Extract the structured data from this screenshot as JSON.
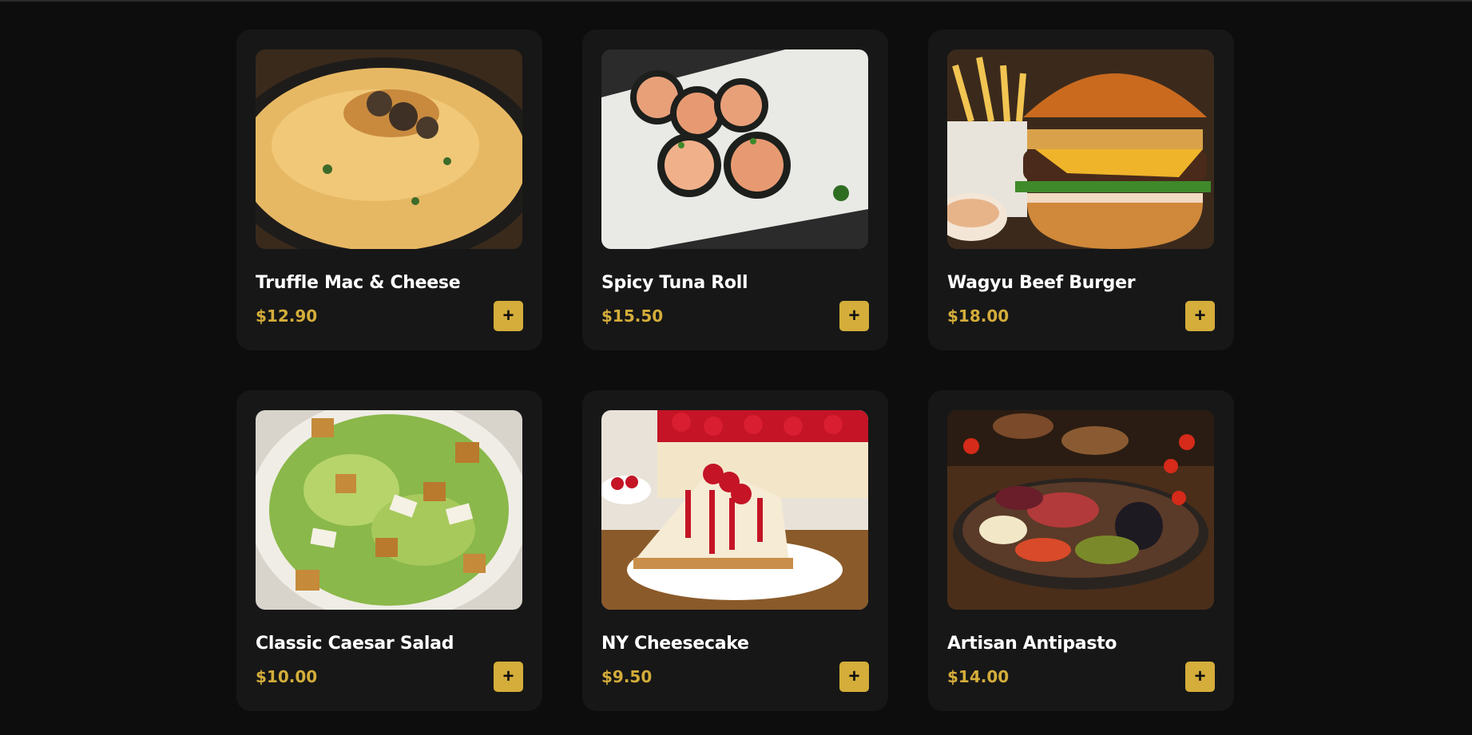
{
  "menu": {
    "items": [
      {
        "name": "Truffle Mac & Cheese",
        "price": "$12.90",
        "add_label": "+"
      },
      {
        "name": "Spicy Tuna Roll",
        "price": "$15.50",
        "add_label": "+"
      },
      {
        "name": "Wagyu Beef Burger",
        "price": "$18.00",
        "add_label": "+"
      },
      {
        "name": "Classic Caesar Salad",
        "price": "$10.00",
        "add_label": "+"
      },
      {
        "name": "NY Cheesecake",
        "price": "$9.50",
        "add_label": "+"
      },
      {
        "name": "Artisan Antipasto",
        "price": "$14.00",
        "add_label": "+"
      }
    ]
  },
  "colors": {
    "background": "#0d0d0d",
    "card": "#171717",
    "accent": "#d4ad3a",
    "title_text": "#ffffff"
  },
  "icons": {
    "add": "plus-icon"
  }
}
